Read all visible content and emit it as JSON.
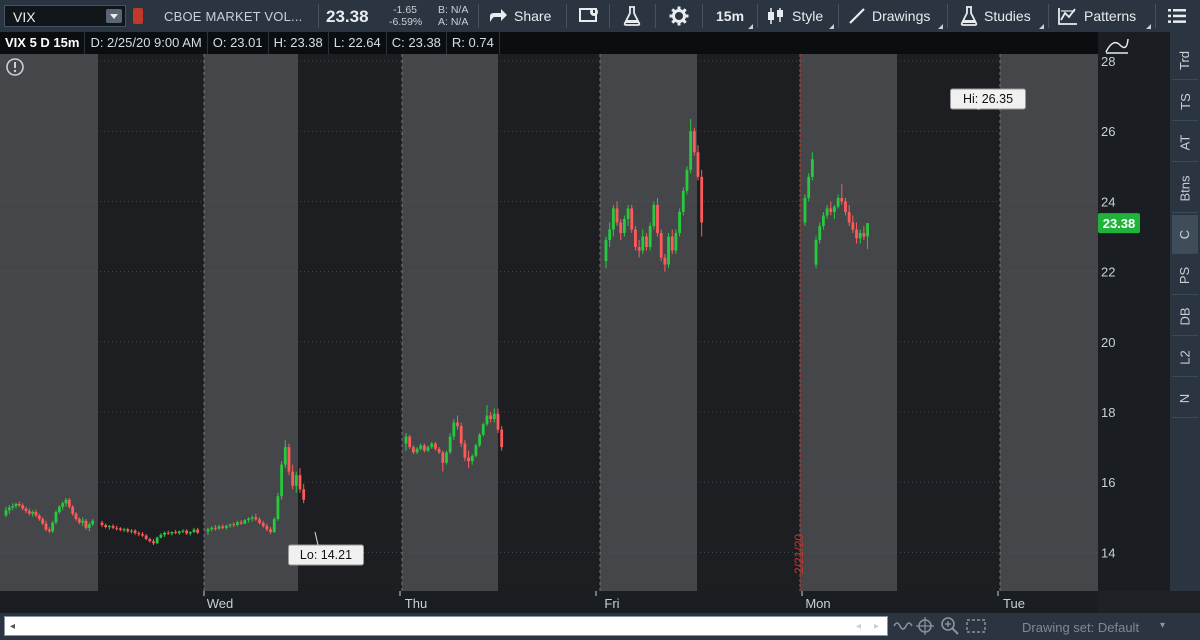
{
  "toolbar": {
    "symbol": "VIX",
    "description": "CBOE MARKET VOL...",
    "last_price": "23.38",
    "net_change": "-1.65",
    "pct_change": "-6.59%",
    "bid": "B: N/A",
    "ask": "A: N/A",
    "share_label": "Share",
    "timeframe_label": "15m",
    "style_label": "Style",
    "drawings_label": "Drawings",
    "studies_label": "Studies",
    "patterns_label": "Patterns"
  },
  "infobar": {
    "title": "VIX 5 D 15m",
    "date": "D: 2/25/20 9:00 AM",
    "open": "O: 23.01",
    "high": "H: 23.38",
    "low": "L: 22.64",
    "close": "C: 23.38",
    "range": "R: 0.74"
  },
  "right_tabs": [
    "Trd",
    "TS",
    "AT",
    "Btns",
    "C",
    "PS",
    "DB",
    "L2",
    "N"
  ],
  "status": {
    "drawing_set": "Drawing set: Default"
  },
  "colors": {
    "up": "#27c93f",
    "down": "#ff5a5a",
    "price_tag": "#1fb33a"
  },
  "chart_data": {
    "type": "candlestick",
    "symbol": "VIX",
    "timeframe": "15m",
    "period": "5 D",
    "y_ticks": [
      14,
      16,
      18,
      20,
      22,
      24,
      26,
      28
    ],
    "ylim": [
      12.9,
      28.2
    ],
    "x_day_labels": [
      "Wed",
      "Thu",
      "Fri",
      "Mon",
      "Tue"
    ],
    "date_marker": "2/21/20",
    "last_price": 23.38,
    "annotations": {
      "high": "Hi: 26.35",
      "low": "Lo: 14.21"
    },
    "series": [
      {
        "day": "Tue",
        "session": [
          [
            15.05,
            15.3,
            15.0,
            15.2
          ],
          [
            15.2,
            15.35,
            15.1,
            15.28
          ],
          [
            15.28,
            15.4,
            15.2,
            15.32
          ],
          [
            15.32,
            15.42,
            15.25,
            15.38
          ],
          [
            15.38,
            15.45,
            15.3,
            15.34
          ],
          [
            15.34,
            15.4,
            15.2,
            15.25
          ],
          [
            15.25,
            15.3,
            15.12,
            15.18
          ],
          [
            15.18,
            15.25,
            15.05,
            15.1
          ],
          [
            15.1,
            15.2,
            15.02,
            15.15
          ],
          [
            15.15,
            15.22,
            15.0,
            15.05
          ],
          [
            15.05,
            15.1,
            14.9,
            14.95
          ],
          [
            14.95,
            15.0,
            14.78,
            14.82
          ],
          [
            14.82,
            14.9,
            14.6,
            14.65
          ],
          [
            14.65,
            14.72,
            14.55,
            14.6
          ],
          [
            14.6,
            14.9,
            14.55,
            14.85
          ],
          [
            14.85,
            15.2,
            14.8,
            15.15
          ],
          [
            15.15,
            15.35,
            15.1,
            15.3
          ],
          [
            15.3,
            15.45,
            15.2,
            15.4
          ],
          [
            15.4,
            15.55,
            15.3,
            15.5
          ],
          [
            15.5,
            15.55,
            15.25,
            15.3
          ],
          [
            15.3,
            15.35,
            15.05,
            15.1
          ],
          [
            15.1,
            15.15,
            14.9,
            14.95
          ],
          [
            14.95,
            15.0,
            14.8,
            14.85
          ],
          [
            14.85,
            15.0,
            14.75,
            14.9
          ],
          [
            14.9,
            14.95,
            14.65,
            14.7
          ],
          [
            14.7,
            14.85,
            14.6,
            14.8
          ],
          [
            14.8,
            14.95,
            14.75,
            14.9
          ]
        ]
      },
      {
        "day": "Wed",
        "session": [
          [
            14.85,
            14.9,
            14.72,
            14.78
          ],
          [
            14.78,
            14.82,
            14.68,
            14.72
          ],
          [
            14.72,
            14.78,
            14.65,
            14.75
          ],
          [
            14.75,
            14.8,
            14.66,
            14.7
          ],
          [
            14.7,
            14.76,
            14.62,
            14.68
          ],
          [
            14.68,
            14.72,
            14.6,
            14.64
          ],
          [
            14.64,
            14.7,
            14.58,
            14.66
          ],
          [
            14.66,
            14.7,
            14.56,
            14.6
          ],
          [
            14.6,
            14.66,
            14.54,
            14.62
          ],
          [
            14.62,
            14.66,
            14.5,
            14.55
          ],
          [
            14.55,
            14.6,
            14.46,
            14.52
          ],
          [
            14.52,
            14.58,
            14.44,
            14.48
          ],
          [
            14.48,
            14.52,
            14.35,
            14.38
          ],
          [
            14.38,
            14.42,
            14.28,
            14.32
          ],
          [
            14.32,
            14.38,
            14.21,
            14.26
          ],
          [
            14.26,
            14.45,
            14.24,
            14.42
          ],
          [
            14.42,
            14.55,
            14.4,
            14.5
          ],
          [
            14.5,
            14.6,
            14.44,
            14.56
          ],
          [
            14.56,
            14.62,
            14.5,
            14.54
          ],
          [
            14.54,
            14.6,
            14.48,
            14.58
          ],
          [
            14.58,
            14.64,
            14.52,
            14.55
          ],
          [
            14.55,
            14.62,
            14.5,
            14.6
          ],
          [
            14.6,
            14.66,
            14.55,
            14.62
          ],
          [
            14.62,
            14.66,
            14.5,
            14.54
          ],
          [
            14.54,
            14.6,
            14.48,
            14.58
          ],
          [
            14.58,
            14.7,
            14.55,
            14.65
          ],
          [
            14.65,
            14.7,
            14.52,
            14.56
          ]
        ]
      },
      {
        "day": "Thu",
        "session": [
          [
            14.6,
            14.7,
            14.5,
            14.66
          ],
          [
            14.66,
            14.75,
            14.6,
            14.7
          ],
          [
            14.7,
            14.78,
            14.62,
            14.68
          ],
          [
            14.68,
            14.78,
            14.64,
            14.74
          ],
          [
            14.74,
            14.8,
            14.66,
            14.7
          ],
          [
            14.7,
            14.78,
            14.65,
            14.76
          ],
          [
            14.76,
            14.82,
            14.7,
            14.8
          ],
          [
            14.8,
            14.86,
            14.72,
            14.78
          ],
          [
            14.78,
            14.9,
            14.74,
            14.86
          ],
          [
            14.86,
            14.92,
            14.78,
            14.82
          ],
          [
            14.82,
            14.95,
            14.8,
            14.92
          ],
          [
            14.92,
            15.0,
            14.85,
            14.96
          ],
          [
            14.96,
            15.05,
            14.88,
            15.0
          ],
          [
            15.0,
            15.1,
            14.9,
            14.94
          ],
          [
            14.94,
            15.0,
            14.8,
            14.84
          ],
          [
            14.84,
            14.9,
            14.7,
            14.75
          ],
          [
            14.75,
            14.82,
            14.6,
            14.66
          ],
          [
            14.66,
            14.72,
            14.52,
            14.58
          ],
          [
            14.58,
            15.0,
            14.55,
            14.95
          ],
          [
            14.95,
            15.7,
            14.9,
            15.6
          ],
          [
            15.6,
            16.6,
            15.5,
            16.5
          ],
          [
            16.5,
            17.2,
            16.4,
            17.0
          ],
          [
            17.0,
            17.1,
            16.2,
            16.3
          ],
          [
            16.3,
            16.5,
            15.8,
            15.9
          ],
          [
            15.9,
            16.3,
            15.7,
            16.2
          ],
          [
            16.2,
            16.4,
            15.7,
            15.8
          ],
          [
            15.8,
            15.95,
            15.4,
            15.5
          ]
        ]
      },
      {
        "day": "Fri",
        "session": [
          [
            17.1,
            17.4,
            16.9,
            17.3
          ],
          [
            17.3,
            17.35,
            16.95,
            17.0
          ],
          [
            17.0,
            17.05,
            16.8,
            16.85
          ],
          [
            16.85,
            17.0,
            16.8,
            16.95
          ],
          [
            16.95,
            17.1,
            16.9,
            17.05
          ],
          [
            17.05,
            17.1,
            16.85,
            16.9
          ],
          [
            16.9,
            17.05,
            16.85,
            17.0
          ],
          [
            17.0,
            17.15,
            16.95,
            17.1
          ],
          [
            17.1,
            17.15,
            16.9,
            16.95
          ],
          [
            16.95,
            17.0,
            16.8,
            16.85
          ],
          [
            16.85,
            16.9,
            16.3,
            16.55
          ],
          [
            16.55,
            16.9,
            16.5,
            16.85
          ],
          [
            16.85,
            17.4,
            16.8,
            17.3
          ],
          [
            17.3,
            17.8,
            17.2,
            17.7
          ],
          [
            17.7,
            17.9,
            17.5,
            17.6
          ],
          [
            17.6,
            17.7,
            17.0,
            17.1
          ],
          [
            17.1,
            17.2,
            16.6,
            16.7
          ],
          [
            16.7,
            16.9,
            16.4,
            16.6
          ],
          [
            16.6,
            16.8,
            16.5,
            16.75
          ],
          [
            16.75,
            17.1,
            16.7,
            17.05
          ],
          [
            17.05,
            17.4,
            17.0,
            17.35
          ],
          [
            17.35,
            17.7,
            17.3,
            17.65
          ],
          [
            17.65,
            18.2,
            17.6,
            17.9
          ],
          [
            17.9,
            18.0,
            17.7,
            17.8
          ],
          [
            17.8,
            18.1,
            17.7,
            17.95
          ],
          [
            17.95,
            18.1,
            17.4,
            17.5
          ],
          [
            17.5,
            17.6,
            16.9,
            17.0
          ]
        ]
      },
      {
        "day": "Mon",
        "session": [
          [
            22.3,
            23.0,
            22.1,
            22.9
          ],
          [
            22.9,
            23.4,
            22.7,
            23.2
          ],
          [
            23.2,
            23.9,
            23.0,
            23.8
          ],
          [
            23.8,
            24.0,
            23.3,
            23.4
          ],
          [
            23.4,
            23.5,
            22.9,
            23.1
          ],
          [
            23.1,
            23.6,
            23.0,
            23.5
          ],
          [
            23.5,
            23.9,
            23.3,
            23.8
          ],
          [
            23.8,
            23.9,
            23.1,
            23.2
          ],
          [
            23.2,
            23.3,
            22.6,
            22.7
          ],
          [
            22.7,
            22.9,
            22.4,
            22.6
          ],
          [
            22.6,
            23.2,
            22.5,
            23.0
          ],
          [
            23.0,
            23.1,
            22.6,
            22.7
          ],
          [
            22.7,
            23.4,
            22.6,
            23.3
          ],
          [
            23.3,
            24.0,
            23.2,
            23.9
          ],
          [
            23.9,
            24.1,
            23.0,
            23.1
          ],
          [
            23.1,
            23.2,
            22.3,
            22.4
          ],
          [
            22.4,
            22.5,
            22.0,
            22.2
          ],
          [
            22.2,
            23.1,
            22.1,
            23.0
          ],
          [
            23.0,
            23.2,
            22.5,
            22.6
          ],
          [
            22.6,
            23.2,
            22.5,
            23.1
          ],
          [
            23.1,
            23.8,
            23.0,
            23.7
          ],
          [
            23.7,
            24.4,
            23.6,
            24.3
          ],
          [
            24.3,
            25.0,
            24.2,
            24.9
          ],
          [
            24.9,
            26.35,
            24.8,
            26.0
          ],
          [
            26.0,
            26.1,
            25.3,
            25.4
          ],
          [
            25.4,
            25.6,
            24.6,
            24.7
          ],
          [
            24.7,
            24.9,
            23.0,
            23.4
          ]
        ]
      },
      {
        "day": "Tue",
        "session": [
          [
            23.4,
            24.2,
            23.3,
            24.1
          ],
          [
            24.1,
            24.8,
            24.0,
            24.7
          ],
          [
            24.7,
            25.4,
            24.6,
            25.2
          ],
          [
            22.2,
            23.0,
            22.1,
            22.9
          ],
          [
            22.9,
            23.4,
            22.8,
            23.3
          ],
          [
            23.3,
            23.7,
            23.2,
            23.6
          ],
          [
            23.6,
            23.9,
            23.5,
            23.8
          ],
          [
            23.8,
            24.0,
            23.6,
            23.7
          ],
          [
            23.7,
            23.9,
            23.5,
            23.85
          ],
          [
            23.85,
            24.2,
            23.8,
            24.1
          ],
          [
            24.1,
            24.5,
            23.9,
            24.0
          ],
          [
            24.0,
            24.1,
            23.6,
            23.7
          ],
          [
            23.7,
            23.9,
            23.3,
            23.4
          ],
          [
            23.4,
            23.6,
            23.1,
            23.2
          ],
          [
            23.2,
            23.4,
            22.8,
            22.95
          ],
          [
            22.95,
            23.2,
            22.8,
            23.1
          ],
          [
            23.1,
            23.3,
            22.9,
            23.0
          ],
          [
            23.0,
            23.38,
            22.64,
            23.38
          ]
        ]
      }
    ]
  }
}
